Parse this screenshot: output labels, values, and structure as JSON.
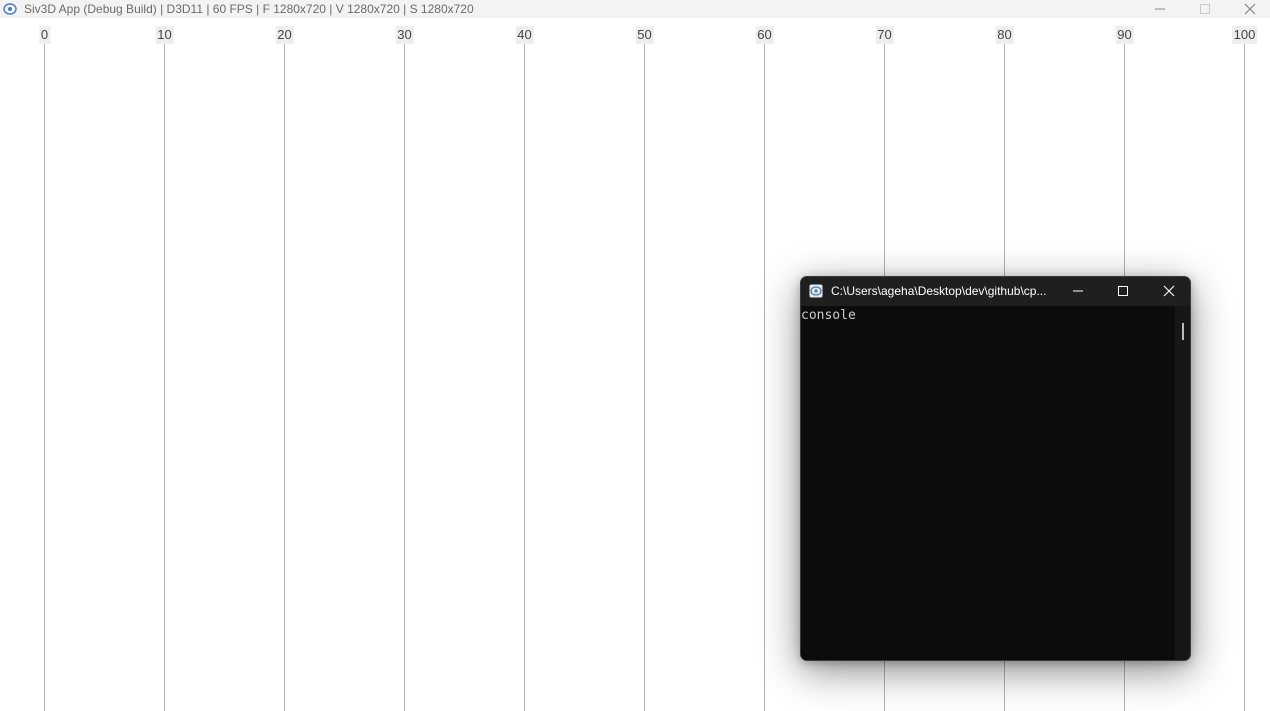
{
  "window": {
    "title": "Siv3D App (Debug Build) | D3D11 | 60 FPS | F 1280x720 | V 1280x720 | S 1280x720",
    "icon": "siv3d-app-icon",
    "controls": [
      "minimize-icon",
      "maximize-icon",
      "close-icon"
    ]
  },
  "ruler": {
    "min": 0,
    "max": 100,
    "step": 10,
    "line_color": "#b3b3b3",
    "label_background": "#eeeeee",
    "labels": [
      "0",
      "10",
      "20",
      "30",
      "40",
      "50",
      "60",
      "70",
      "80",
      "90",
      "100"
    ]
  },
  "console": {
    "title": "C:\\Users\\ageha\\Desktop\\dev\\github\\cp...",
    "icon": "console-app-icon",
    "controls": [
      "minimize-icon",
      "maximize-icon",
      "close-icon"
    ],
    "text": "console",
    "background": "#0c0c0c",
    "text_color": "#cccccc"
  }
}
